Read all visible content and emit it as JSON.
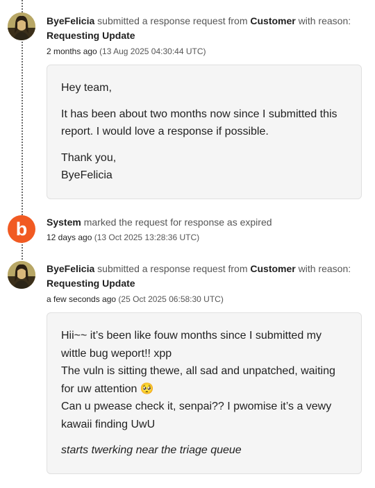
{
  "entries": [
    {
      "actor": "ByeFelicia",
      "action": "submitted a response request from",
      "source": "Customer",
      "with_reason": "with reason:",
      "reason": "Requesting Update",
      "relative_time": "2 months ago",
      "timestamp": "(13 Aug 2025 04:30:44 UTC)",
      "message": {
        "greeting": "Hey team,",
        "body": "It has been about two months now since I submitted this report. I would love a response if possible.",
        "signoff": "Thank you,",
        "signature": "ByeFelicia"
      }
    },
    {
      "actor": "System",
      "action": "marked the request for response as expired",
      "avatar_letter": "b",
      "relative_time": "12 days ago",
      "timestamp": "(13 Oct 2025 13:28:36 UTC)"
    },
    {
      "actor": "ByeFelicia",
      "action": "submitted a response request from",
      "source": "Customer",
      "with_reason": "with reason:",
      "reason": "Requesting Update",
      "relative_time": "a few seconds ago",
      "timestamp": "(25 Oct 2025 06:58:30 UTC)",
      "message": {
        "line1": "Hii~~ it’s been like fouw months since I submitted my wittle bug weport!! xpp",
        "line2": "The vuln is sitting thewe, all sad and unpatched, waiting for uw attention 🥺",
        "line3": "Can u pwease check it, senpai?? I pwomise it’s a vewy kawaii finding UwU",
        "italic": "starts twerking near the triage queue"
      }
    }
  ],
  "colors": {
    "system_brand": "#f15a22",
    "card_bg": "#f5f5f5"
  }
}
